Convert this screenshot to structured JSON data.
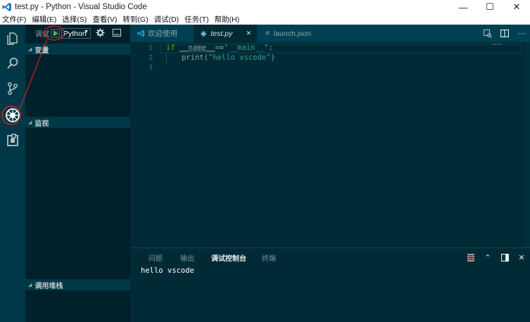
{
  "window": {
    "title": "test.py - Python - Visual Studio Code",
    "controls": {
      "minimize": "—",
      "maximize": "☐",
      "close": "✕"
    }
  },
  "menu": [
    "文件(F)",
    "编辑(E)",
    "选择(S)",
    "查看(V)",
    "转到(G)",
    "调试(D)",
    "任务(T)",
    "帮助(H)"
  ],
  "activity": [
    {
      "name": "explorer-icon"
    },
    {
      "name": "search-icon"
    },
    {
      "name": "source-control-icon"
    },
    {
      "name": "debug-icon",
      "active": true
    },
    {
      "name": "extensions-icon"
    }
  ],
  "sidebar": {
    "debug_label": "调试",
    "config_selected": "Python",
    "sections": {
      "variables": "变量",
      "watch": "监视",
      "callstack": "调用堆栈"
    }
  },
  "tabs": [
    {
      "label": "欢迎使用",
      "icon": "vscode-icon"
    },
    {
      "label": "test.py",
      "icon": "python-file-icon",
      "active": true,
      "close": "✕"
    },
    {
      "label": "launch.json",
      "icon": "json-file-icon"
    }
  ],
  "editor": {
    "line_numbers": [
      "1",
      "2",
      "3"
    ],
    "line1": {
      "kw_if": "if",
      "name": "__name__",
      "eq": "==",
      "main": "\"__main__\"",
      "colon": ":"
    },
    "line2": {
      "fn": "print(",
      "arg": "\"hello vscode\"",
      "close": ")"
    }
  },
  "panel": {
    "tabs": [
      "问题",
      "输出",
      "调试控制台",
      "终端"
    ],
    "active_tab": "调试控制台",
    "output": "hello vscode"
  },
  "colors": {
    "background": "#002b36",
    "sidebar": "#00212b",
    "activity": "#003847",
    "keyword": "#859900",
    "string": "#2aa198",
    "annotation": "#e0281c",
    "play": "#6ab04c"
  }
}
